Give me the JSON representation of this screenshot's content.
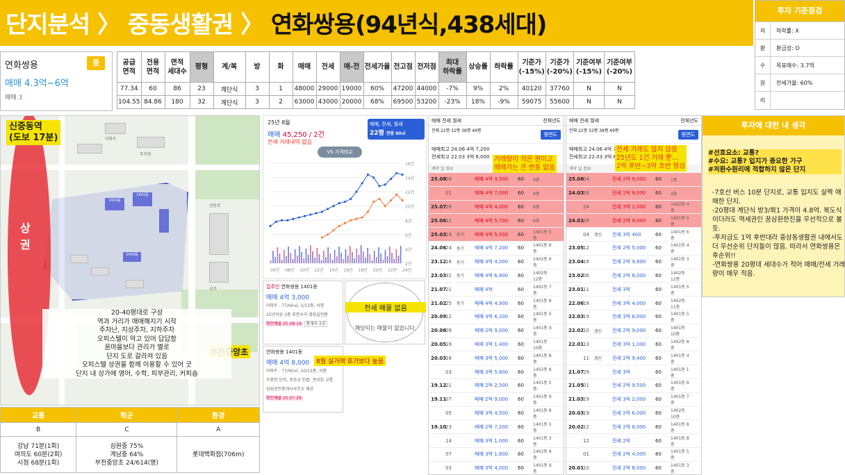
{
  "header": {
    "crumb1": "단지분석",
    "crumb2": "중동생활권",
    "crumb3": "연화쌍용(94년식,438세대)",
    "sep": "〉"
  },
  "criteria": {
    "title": "투자 기준점검",
    "rows": [
      {
        "k": "저",
        "v": "하락률: X"
      },
      {
        "k": "환",
        "v": "환금성: O"
      },
      {
        "k": "수",
        "v": "목표매수: 3.7억"
      },
      {
        "k": "원",
        "v": "전세가율: 60%"
      },
      {
        "k": "리",
        "v": ""
      }
    ]
  },
  "apt": {
    "name": "연화쌍용",
    "badge": "중",
    "price": "매매 4.3억~6억",
    "type_label": "매매",
    "type_count": "3"
  },
  "table": {
    "headers": [
      {
        "t": "공급\n면적",
        "g": false
      },
      {
        "t": "전용\n면적",
        "g": false
      },
      {
        "t": "면적\n세대수",
        "g": false
      },
      {
        "t": "평형",
        "g": true
      },
      {
        "t": "계/복",
        "g": false
      },
      {
        "t": "방",
        "g": false
      },
      {
        "t": "화",
        "g": false
      },
      {
        "t": "매매",
        "g": false
      },
      {
        "t": "전세",
        "g": false
      },
      {
        "t": "매-전",
        "g": true
      },
      {
        "t": "전세가율",
        "g": false
      },
      {
        "t": "전고점",
        "g": false
      },
      {
        "t": "전저점",
        "g": false
      },
      {
        "t": "최대\n하락률",
        "g": true
      },
      {
        "t": "상승률",
        "g": false
      },
      {
        "t": "하락률",
        "g": false
      },
      {
        "t": "기준가\n(-15%)",
        "g": false
      },
      {
        "t": "기준가\n(-20%)",
        "g": false
      },
      {
        "t": "기준여부\n(-15%)",
        "g": false
      },
      {
        "t": "기준여부\n(-20%)",
        "g": false
      }
    ],
    "rows": [
      [
        "77.34",
        "60",
        "86",
        "23",
        "계단식",
        "3",
        "1",
        "48000",
        "29000",
        "19000",
        "60%",
        "47200",
        "44000",
        "-7%",
        "9%",
        "2%",
        "40120",
        "37760",
        "N",
        "N"
      ],
      [
        "104.55",
        "84.86",
        "180",
        "32",
        "계단식",
        "3",
        "2",
        "63000",
        "43000",
        "20000",
        "68%",
        "69500",
        "53200",
        "-23%",
        "18%",
        "-9%",
        "59075",
        "55600",
        "N",
        "N"
      ]
    ]
  },
  "map": {
    "station": "신중동역\n(도보 17분)",
    "sangkwon": "상권",
    "school": "부천중앙초",
    "note": [
      "20-40평대로 구성",
      "역과 거리가 애매해지기 시작",
      "주차난, 지상주차, 지하주차",
      "오피스텔이 막고 있어 답답함",
      "꿈마을보다 관리가 별로",
      "단지 도로 갈라져 있음",
      "오피스텔 상권을 함께 이용할 수 있어 굿",
      "단지 내 상가에 영어, 수학, 피부관리, 커피숍"
    ],
    "labels": [
      "신중동역",
      "부천중앙초",
      "상동초",
      "중동초",
      "아파트",
      "주차장",
      "상가"
    ]
  },
  "grade": {
    "headers": [
      "교통",
      "학군",
      "환경"
    ],
    "grades": [
      "B",
      "C",
      "A"
    ],
    "details": [
      "강남 71분(1회)\n여의도 60분(2회)\n시청 68분(1회)",
      "심원중 75%\n계남중 64%\n부천중앙초 24/614(명)",
      "롯데백화점(706m)"
    ]
  },
  "chart": {
    "date": "25년 8월",
    "price_label": "매매",
    "price": "45,250 / 2건",
    "note": "전세 거래내역 없음",
    "legend1": "매매, 전세, 월세",
    "legend2": "22평",
    "legend3": "전용 60㎡",
    "compare": "VS 가격비교",
    "x_ticks": [
      "06년",
      "08년",
      "10년",
      "12년",
      "14년",
      "16년",
      "18년",
      "20년",
      "22년",
      "24년"
    ],
    "y_ticks": [
      "16억",
      "14억",
      "12억",
      "10억",
      "8억",
      "6억",
      "4억",
      "2억"
    ],
    "right_ticks": [
      "16건",
      "14건",
      "12건",
      "10건",
      "8건",
      "6건",
      "4건",
      "2건"
    ]
  },
  "chart_data": {
    "type": "line",
    "x_ticks": [
      "06년",
      "08년",
      "10년",
      "12년",
      "14년",
      "16년",
      "18년",
      "20년",
      "22년",
      "24년"
    ],
    "series": [
      {
        "name": "매매",
        "color": "#2b5fd6",
        "values": [
          2.6,
          2.9,
          3.0,
          3.0,
          3.1,
          3.2,
          3.3,
          3.4,
          3.5,
          3.6,
          3.8,
          4.0,
          4.2,
          4.3,
          4.5,
          5.0,
          5.6,
          6.2,
          6.0,
          5.4,
          5.5,
          5.9,
          6.3,
          6.2
        ]
      },
      {
        "name": "전세",
        "color": "#f08040",
        "values": [
          null,
          null,
          null,
          null,
          null,
          null,
          null,
          null,
          null,
          1.8,
          2.0,
          2.3,
          2.6,
          2.8,
          3.0,
          3.1,
          3.2,
          3.6,
          4.3,
          4.5,
          4.0,
          4.4,
          4.8,
          4.4
        ]
      }
    ]
  },
  "listing1": {
    "tag": "집주인",
    "name": "연화쌍용 1401동",
    "price": "매매 4억 3,000",
    "detail": "아파트 · 77/60㎡, 1/13층, 서향",
    "detail2": "25년이상  1층  부분수리  화장실전환",
    "badge": "확인매물 25.08.14.",
    "agent": "중개사 2곳"
  },
  "listing2": {
    "name": "연화쌍용 1401동",
    "price": "매매 4억 8,000",
    "detail": "아파트 · 77/60㎡, 10/13층, 서향",
    "detail2": "조용한 단지, 초등교 인접. 관리된 교통",
    "detail3": "삼성공인중개사사무소  제공",
    "badge": "확인매물 25.07.29."
  },
  "nolisting": {
    "title": "전세 매물 없음",
    "desc": "해당되는 매물이 없습니다."
  },
  "aug_note": "8월 실거래 호가보다 높음",
  "tx1": {
    "tabs": "매매  전세  월세",
    "filter": "전체년도",
    "sub": "전체  22평  32평  38평  49평",
    "btn": "평면도",
    "sum1": "매매최고 24.06  4억 7,200",
    "sum2": "전세최고 22.03  3억 6,000",
    "hd": "계약  일  정보",
    "note": "거래량이 적은 편이고\n매매가는 큰 변동 없음",
    "rows": [
      {
        "d": "25.08",
        "dd": "09",
        "k": "",
        "p": "매매 4억 3,500",
        "a": "60",
        "f": "9층",
        "hot": true
      },
      {
        "d": "",
        "dd": "01",
        "k": "",
        "p": "매매 4억 7,000",
        "a": "60",
        "f": "4층",
        "hot": true
      },
      {
        "d": "25.07",
        "dd": "29",
        "k": "",
        "p": "매매 4억 4,000",
        "a": "60",
        "f": "8층",
        "hot": true
      },
      {
        "d": "25.06",
        "dd": "11",
        "k": "",
        "p": "매매 4억 5,700",
        "a": "60",
        "f": "6층",
        "hot": true
      },
      {
        "d": "25.03",
        "dd": "19",
        "k": "동기",
        "p": "매매 4억 5,500",
        "a": "60",
        "f": "1401동 5층",
        "hot": true
      },
      {
        "d": "24.06",
        "dd": "24",
        "k": "동기",
        "p": "매매 4억 7,200",
        "a": "60",
        "f": "1401동 8층",
        "hot": false
      },
      {
        "d": "23.12",
        "dd": "16",
        "k": "동기",
        "p": "매매 4억 4,000",
        "a": "60",
        "f": "1402동 9층",
        "hot": false
      },
      {
        "d": "23.03",
        "dd": "31",
        "k": "동기",
        "p": "매매 4억 6,800",
        "a": "60",
        "f": "1402동 12층",
        "hot": false
      },
      {
        "d": "21.07",
        "dd": "21",
        "k": "",
        "p": "매매 4억",
        "a": "60",
        "f": "1402동 7층",
        "hot": false
      },
      {
        "d": "21.02",
        "dd": "25",
        "k": "동기",
        "p": "매매 4억 4,900",
        "a": "60",
        "f": "1401동 8층",
        "hot": false
      },
      {
        "d": "20.09",
        "dd": "12",
        "k": "",
        "p": "매매 3억 6,200",
        "a": "60",
        "f": "1401동 5층",
        "hot": false
      },
      {
        "d": "20.06",
        "dd": "09",
        "k": "",
        "p": "매매 2억 9,000",
        "a": "60",
        "f": "1401동 4층",
        "hot": false
      },
      {
        "d": "20.05",
        "dd": "19",
        "k": "",
        "p": "매매 3억 1,400",
        "a": "60",
        "f": "1401동 10층",
        "hot": false
      },
      {
        "d": "20.03",
        "dd": "16",
        "k": "",
        "p": "매매 3억 5,000",
        "a": "60",
        "f": "1401동 8층",
        "hot": false
      },
      {
        "d": "",
        "dd": "03",
        "k": "",
        "p": "매매 3억 5,800",
        "a": "60",
        "f": "1402동 8층",
        "hot": false
      },
      {
        "d": "19.12",
        "dd": "21",
        "k": "",
        "p": "매매 2억 2,500",
        "a": "60",
        "f": "1401동 5층",
        "hot": false
      },
      {
        "d": "19.11",
        "dd": "07",
        "k": "",
        "p": "매매 2억 9,000",
        "a": "60",
        "f": "1401동 9층",
        "hot": false
      },
      {
        "d": "",
        "dd": "05",
        "k": "",
        "p": "매매 3억 4,500",
        "a": "60",
        "f": "1401동 8층",
        "hot": false
      },
      {
        "d": "19.10",
        "dd": "23",
        "k": "",
        "p": "매매 2억 7,200",
        "a": "60",
        "f": "1401동 5층",
        "hot": false
      },
      {
        "d": "",
        "dd": "14",
        "k": "",
        "p": "매매 3억 1,000",
        "a": "60",
        "f": "1401동 3층",
        "hot": false
      },
      {
        "d": "",
        "dd": "07",
        "k": "",
        "p": "매매 3억 1,800",
        "a": "60",
        "f": "1402동 8층",
        "hot": false
      },
      {
        "d": "",
        "dd": "03",
        "k": "",
        "p": "매매 3억 4,000",
        "a": "60",
        "f": "1401동 9층",
        "hot": false
      }
    ]
  },
  "tx2": {
    "tabs": "매매  전세  월세",
    "filter": "전체년도",
    "sub": "전체  22평  32평  38평  49평",
    "btn": "평면도",
    "sum1": "매매최고 24.06  4억 7,2",
    "sum2": "전세최고 22.03  3억 6,0",
    "hd": "계약  일  정보",
    "note": "전세 거래도 많지 않음\n25년도 1건 거래 뿐…\n2억 후반~3억 초반 형성",
    "rows": [
      {
        "d": "25.06",
        "dd": "04",
        "k": "",
        "p": "전세 2억 9,000",
        "a": "60",
        "f": "1층",
        "hot": true
      },
      {
        "d": "24.03",
        "dd": "26",
        "k": "",
        "p": "전세 2억 9,000",
        "a": "60",
        "f": "4층",
        "hot": true
      },
      {
        "d": "",
        "dd": "24",
        "k": "",
        "p": "전세 3억 2,000",
        "a": "60",
        "f": "1402동 4층",
        "hot": true
      },
      {
        "d": "24.01",
        "dd": "09",
        "k": "",
        "p": "전세 2억 9,000",
        "a": "60",
        "f": "1401동 5층",
        "hot": true
      },
      {
        "d": "",
        "dd": "04",
        "k": "갱신",
        "p": "전세 3억 400",
        "a": "60",
        "f": "1401동 6층",
        "hot": false
      },
      {
        "d": "23.05",
        "dd": "12",
        "k": "",
        "p": "전세 2억 5,000",
        "a": "60",
        "f": "1401동 4층",
        "hot": false
      },
      {
        "d": "23.04",
        "dd": "16",
        "k": "",
        "p": "전세 2억 9,800",
        "a": "60",
        "f": "1401동 3층",
        "hot": false
      },
      {
        "d": "23.02",
        "dd": "06",
        "k": "",
        "p": "전세 2억 8,000",
        "a": "60",
        "f": "1402동 12층",
        "hot": false
      },
      {
        "d": "23.01",
        "dd": "11",
        "k": "",
        "p": "전세 3억",
        "a": "60",
        "f": "1401동 5층",
        "hot": false
      },
      {
        "d": "22.06",
        "dd": "18",
        "k": "",
        "p": "전세 3억 4,000",
        "a": "60",
        "f": "1402동 11층",
        "hot": false
      },
      {
        "d": "22.03",
        "dd": "19",
        "k": "",
        "p": "전세 3억 6,000",
        "a": "60",
        "f": "1401동 5층",
        "hot": false
      },
      {
        "d": "22.02",
        "dd": "10",
        "k": "갱신",
        "p": "전세 2억 9,000",
        "a": "60",
        "f": "1401동 10층",
        "hot": false
      },
      {
        "d": "22.01",
        "dd": "13",
        "k": "",
        "p": "전세 3억 1,000",
        "a": "60",
        "f": "1402동 8층",
        "hot": false
      },
      {
        "d": "",
        "dd": "11",
        "k": "갱신",
        "p": "전세 2억 9,400",
        "a": "60",
        "f": "1401동 4층",
        "hot": false
      },
      {
        "d": "21.07",
        "dd": "29",
        "k": "",
        "p": "전세 3억",
        "a": "60",
        "f": "1401동 1층",
        "hot": false
      },
      {
        "d": "21.05",
        "dd": "01",
        "k": "",
        "p": "전세 2억 9,500",
        "a": "60",
        "f": "1401동 9층",
        "hot": false
      },
      {
        "d": "21.03",
        "dd": "19",
        "k": "",
        "p": "전세 3억 2,000",
        "a": "60",
        "f": "1401동 7층",
        "hot": false
      },
      {
        "d": "20.03",
        "dd": "19",
        "k": "",
        "p": "전세 2억 6,000",
        "a": "60",
        "f": "1402동 10층",
        "hot": false
      },
      {
        "d": "20.02",
        "dd": "12",
        "k": "",
        "p": "전세 2억 8,000",
        "a": "60",
        "f": "1401동 8층",
        "hot": false
      },
      {
        "d": "",
        "dd": "12",
        "k": "",
        "p": "전세 2억",
        "a": "60",
        "f": "1401동 8층",
        "hot": false
      },
      {
        "d": "",
        "dd": "01",
        "k": "",
        "p": "전세 2억 4,000",
        "a": "60",
        "f": "1401동 5층",
        "hot": false
      },
      {
        "d": "20.01",
        "dd": "10",
        "k": "",
        "p": "전세 2억 8,000",
        "a": "60",
        "f": "1401동 3층",
        "hot": false
      }
    ]
  },
  "thoughts": {
    "title": "투자에 대한 내 생각",
    "tags": "#선호요소: 교통?\n#수요: 교통? 입지가 중요한 가구\n#저환수원리에 적합하지 않은 단지",
    "body": "-7호선 버스 10분 단지로, 교통 입지도 살짝 애매한 단지.\n-20평대 계단식 방3/화1 가격이 4.8억. 복도식이더라도 역세권인 꿈삼환한진을 우선적으로 볼 듯.\n-투자금도 1억 후반대라 중상동생활권 내에서도 더 우선순위 단지들이 많음. 따라서 연화쌍용은 후순위!!\n-연화쌍용 20평대 세대수가 적어 매매/전세 거래량이 매우 적음."
  }
}
